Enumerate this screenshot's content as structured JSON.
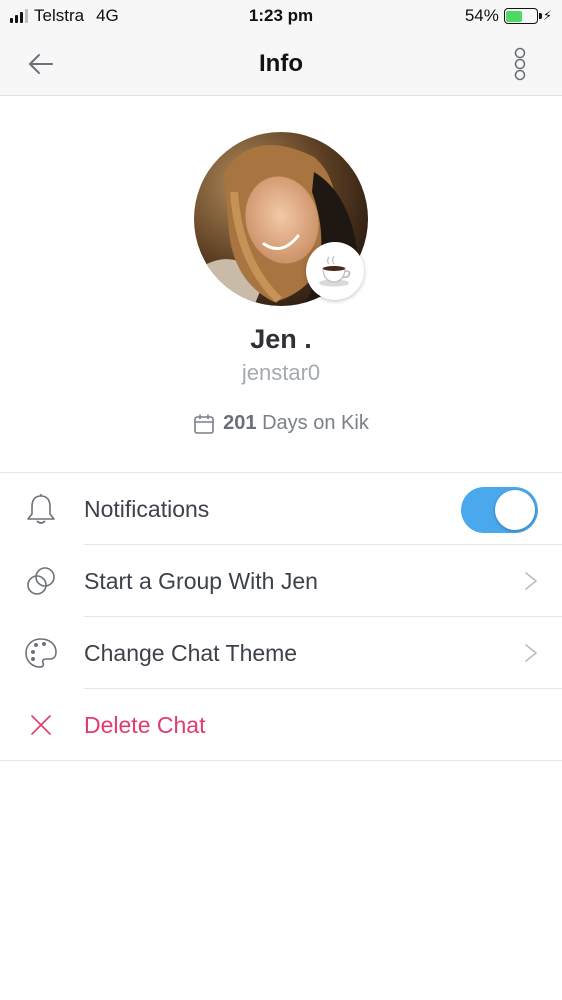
{
  "status_bar": {
    "carrier": "Telstra",
    "network": "4G",
    "time": "1:23 pm",
    "battery_percent": "54%",
    "battery_level": 0.54,
    "battery_color": "#4cd964"
  },
  "header": {
    "title": "Info",
    "back_icon": "arrow-left-icon",
    "more_icon": "vertical-dots-icon"
  },
  "profile": {
    "name": "Jen .",
    "username": "jenstar0",
    "days_count": "201",
    "days_text": "Days on Kik",
    "mood_icon": "coffee-cup-icon",
    "avatar": "profile-photo"
  },
  "menu": {
    "items": [
      {
        "label": "Notifications",
        "icon": "bell-icon",
        "control": "toggle",
        "toggle_on": true
      },
      {
        "label": "Start a Group With Jen",
        "icon": "group-circles-icon",
        "control": "chevron"
      },
      {
        "label": "Change Chat Theme",
        "icon": "palette-icon",
        "control": "chevron"
      },
      {
        "label": "Delete Chat",
        "icon": "close-x-icon",
        "control": "none"
      }
    ]
  },
  "colors": {
    "accent": "#4aa8ec",
    "danger": "#e23b6d",
    "text_primary": "#2f3136",
    "text_secondary": "#a5a9b1"
  }
}
